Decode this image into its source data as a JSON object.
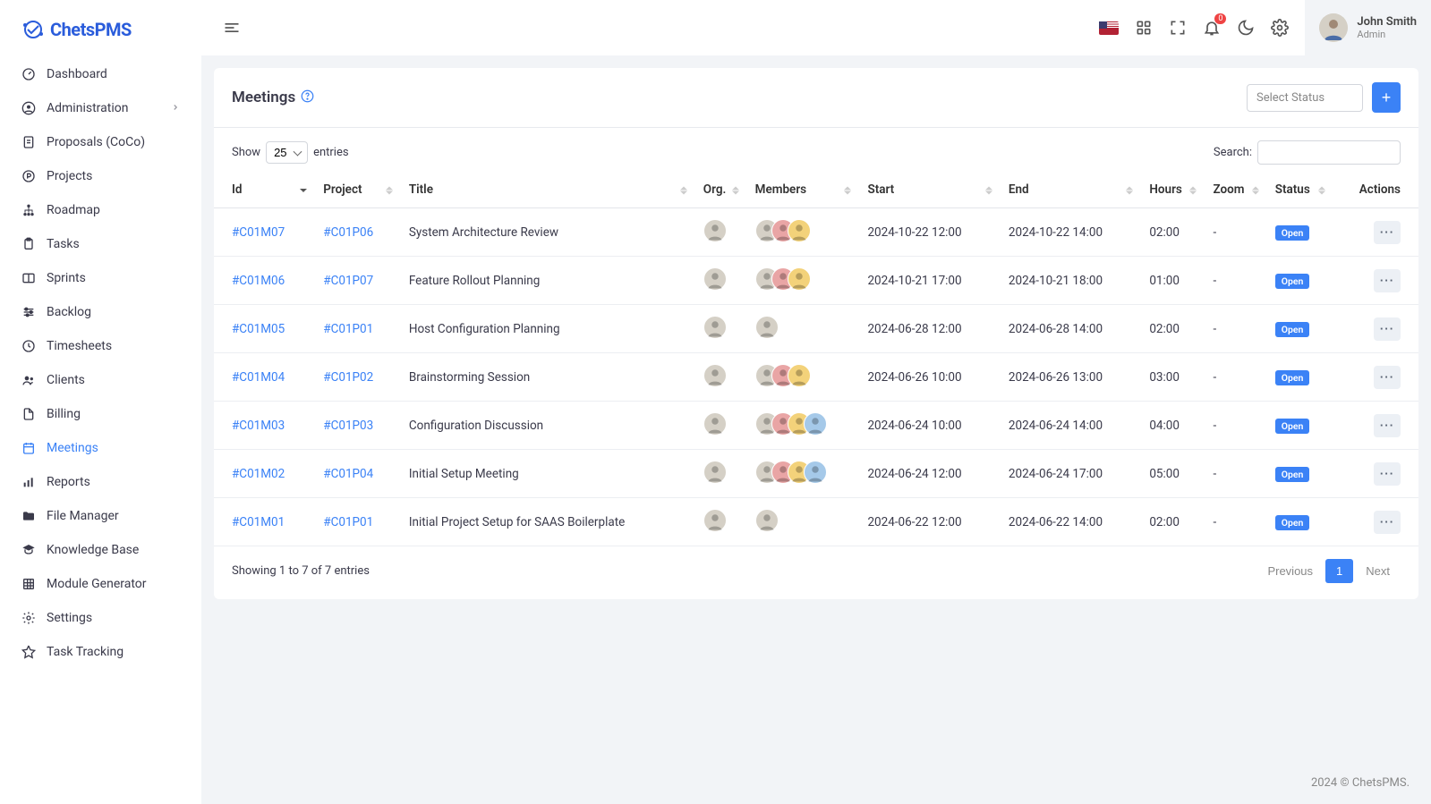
{
  "brand": "ChetsPMS",
  "user": {
    "name": "John Smith",
    "role": "Admin"
  },
  "topbar": {
    "notification_count": "0"
  },
  "sidebar": {
    "items": [
      {
        "label": "Dashboard",
        "icon": "gauge"
      },
      {
        "label": "Administration",
        "icon": "user-circle",
        "expandable": true
      },
      {
        "label": "Proposals (CoCo)",
        "icon": "file-lines"
      },
      {
        "label": "Projects",
        "icon": "circle-p"
      },
      {
        "label": "Roadmap",
        "icon": "sitemap"
      },
      {
        "label": "Tasks",
        "icon": "clipboard"
      },
      {
        "label": "Sprints",
        "icon": "columns"
      },
      {
        "label": "Backlog",
        "icon": "sliders"
      },
      {
        "label": "Timesheets",
        "icon": "clock"
      },
      {
        "label": "Clients",
        "icon": "users"
      },
      {
        "label": "Billing",
        "icon": "file"
      },
      {
        "label": "Meetings",
        "icon": "calendar",
        "active": true
      },
      {
        "label": "Reports",
        "icon": "chart"
      },
      {
        "label": "File Manager",
        "icon": "folder"
      },
      {
        "label": "Knowledge Base",
        "icon": "graduation"
      },
      {
        "label": "Module Generator",
        "icon": "grid"
      },
      {
        "label": "Settings",
        "icon": "gear"
      },
      {
        "label": "Task Tracking",
        "icon": "star"
      }
    ]
  },
  "page": {
    "title": "Meetings",
    "status_placeholder": "Select Status",
    "show_label_pre": "Show",
    "show_label_post": "entries",
    "show_value": "25",
    "search_label": "Search:",
    "columns": [
      "Id",
      "Project",
      "Title",
      "Org.",
      "Members",
      "Start",
      "End",
      "Hours",
      "Zoom",
      "Status",
      "Actions"
    ],
    "rows": [
      {
        "id": "#C01M07",
        "project": "#C01P06",
        "title": "System Architecture Review",
        "members": 3,
        "start": "2024-10-22 12:00",
        "end": "2024-10-22 14:00",
        "hours": "02:00",
        "zoom": "-",
        "status": "Open"
      },
      {
        "id": "#C01M06",
        "project": "#C01P07",
        "title": "Feature Rollout Planning",
        "members": 3,
        "start": "2024-10-21 17:00",
        "end": "2024-10-21 18:00",
        "hours": "01:00",
        "zoom": "-",
        "status": "Open"
      },
      {
        "id": "#C01M05",
        "project": "#C01P01",
        "title": "Host Configuration Planning",
        "members": 1,
        "start": "2024-06-28 12:00",
        "end": "2024-06-28 14:00",
        "hours": "02:00",
        "zoom": "-",
        "status": "Open"
      },
      {
        "id": "#C01M04",
        "project": "#C01P02",
        "title": "Brainstorming Session",
        "members": 3,
        "start": "2024-06-26 10:00",
        "end": "2024-06-26 13:00",
        "hours": "03:00",
        "zoom": "-",
        "status": "Open"
      },
      {
        "id": "#C01M03",
        "project": "#C01P03",
        "title": "Configuration Discussion",
        "members": 4,
        "start": "2024-06-24 10:00",
        "end": "2024-06-24 14:00",
        "hours": "04:00",
        "zoom": "-",
        "status": "Open"
      },
      {
        "id": "#C01M02",
        "project": "#C01P04",
        "title": "Initial Setup Meeting",
        "members": 4,
        "start": "2024-06-24 12:00",
        "end": "2024-06-24 17:00",
        "hours": "05:00",
        "zoom": "-",
        "status": "Open"
      },
      {
        "id": "#C01M01",
        "project": "#C01P01",
        "title": "Initial Project Setup for SAAS Boilerplate",
        "members": 1,
        "start": "2024-06-22 12:00",
        "end": "2024-06-22 14:00",
        "hours": "02:00",
        "zoom": "-",
        "status": "Open"
      }
    ],
    "info_text": "Showing 1 to 7 of 7 entries",
    "pager": {
      "prev": "Previous",
      "pages": [
        "1"
      ],
      "next": "Next"
    }
  },
  "footer": "2024 © ChetsPMS."
}
